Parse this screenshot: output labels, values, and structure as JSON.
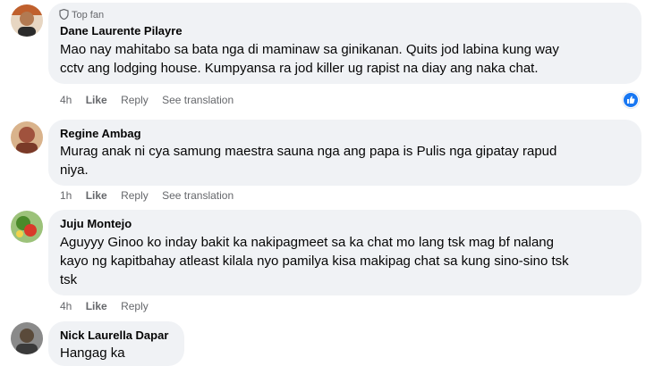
{
  "comments": [
    {
      "badge": "Top fan",
      "author": "Dane Laurente Pilayre",
      "text_lines": [
        "Mao nay mahitabo sa bata nga di maminaw sa ginikanan. Quits jod labina kung way",
        "cctv ang lodging house. Kumpyansa ra jod killer ug rapist na diay ang naka chat."
      ],
      "time": "4h",
      "like": "Like",
      "reply": "Reply",
      "translate": "See translation",
      "reaction_icon": "like-icon",
      "avatar_colors": [
        "#c0602d",
        "#2b2b2b"
      ]
    },
    {
      "author": "Regine Ambag",
      "text_lines": [
        "Murag anak ni cya samung maestra sauna nga ang papa is Pulis nga gipatay rapud",
        "niya."
      ],
      "time": "1h",
      "like": "Like",
      "reply": "Reply",
      "translate": "See translation",
      "avatar_colors": [
        "#a0523d",
        "#d9b38c"
      ]
    },
    {
      "author": "Juju Montejo",
      "text_lines": [
        "Aguyyy Ginoo ko inday bakit ka nakipagmeet sa ka chat mo lang tsk mag bf nalang",
        "kayo ng kapitbahay atleast kilala nyo pamilya kisa makipag chat sa kung sino-sino tsk",
        "tsk"
      ],
      "time": "4h",
      "like": "Like",
      "reply": "Reply",
      "avatar_colors": [
        "#4a8a2a",
        "#d93a2a"
      ]
    },
    {
      "author": "Nick Laurella Dapar",
      "text_lines": [
        "Hangag ka"
      ],
      "avatar_colors": [
        "#3a3a3a",
        "#8a8a8a"
      ]
    }
  ],
  "colors": {
    "bubble": "#f0f2f5",
    "meta": "#65676b",
    "like_blue": "#1877f2"
  }
}
